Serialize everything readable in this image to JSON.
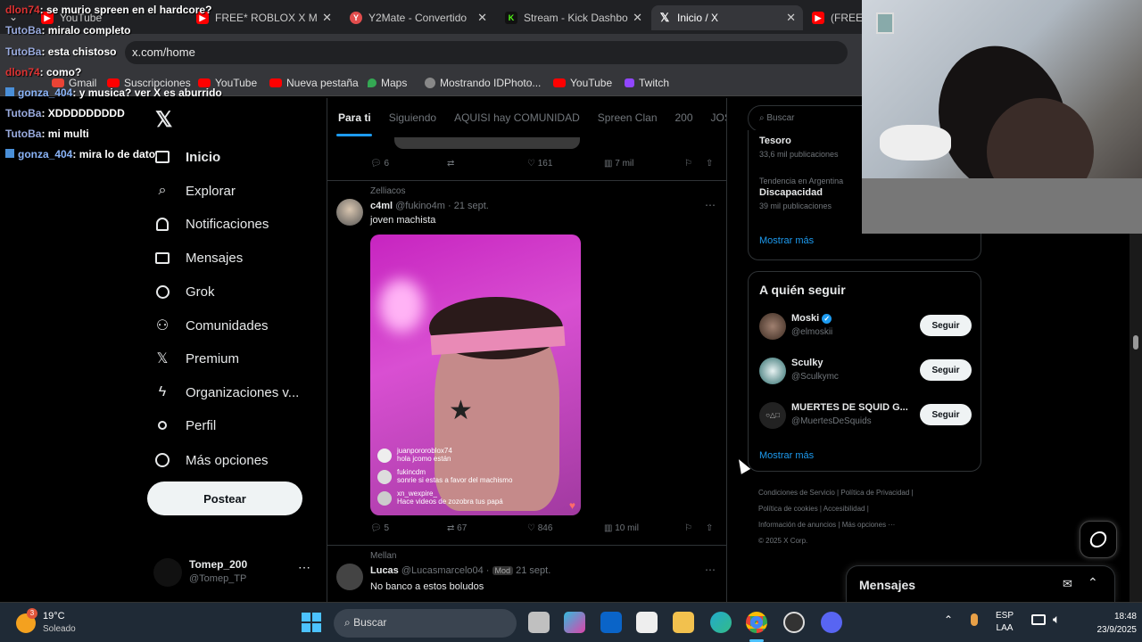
{
  "browser": {
    "tabs": [
      {
        "label": "YouTube",
        "color": "#ff0000"
      },
      {
        "label": "FREE* ROBLOX X M",
        "color": "#ff0000"
      },
      {
        "label": "Y2Mate - Convertido",
        "color": "#e24d4d"
      },
      {
        "label": "Stream - Kick Dashbo",
        "color": "#53fc18"
      },
      {
        "label": "Inicio / X",
        "color": "#000000"
      },
      {
        "label": "(FREE)",
        "color": "#ff0000"
      }
    ],
    "url": "x.com/home",
    "bookmarks": [
      "Gmail",
      "Suscripciones",
      "YouTube",
      "Nueva pestaña",
      "Maps",
      "Mostrando IDPhoto...",
      "YouTube",
      "Twitch"
    ]
  },
  "chat": [
    {
      "user": "dlon74",
      "text": ": se murio spreen en el hardcore?"
    },
    {
      "user": "TutoBa",
      "text": ": miralo completo"
    },
    {
      "user": "TutoBa",
      "text": ": esta chistoso"
    },
    {
      "user": "dlon74",
      "text": ": como?"
    },
    {
      "user": "gonza_404",
      "text": ": y musica? ver X es aburrido"
    },
    {
      "user": "TutoBa",
      "text": ": XDDDDDDDDD"
    },
    {
      "user": "TutoBa",
      "text": ": mi multi"
    },
    {
      "user": "gonza_404",
      "text": ": mira lo de dato"
    }
  ],
  "nav": {
    "items": [
      "Inicio",
      "Explorar",
      "Notificaciones",
      "Mensajes",
      "Grok",
      "Comunidades",
      "Premium",
      "Organizaciones v...",
      "Perfil",
      "Más opciones"
    ],
    "post_label": "Postear",
    "account_name": "Tomep_200",
    "account_handle": "@Tomep_TP"
  },
  "feed": {
    "tabs": [
      "Para ti",
      "Siguiendo",
      "AQUISI hay COMUNIDAD",
      "Spreen Clan",
      "200",
      "JOSI"
    ],
    "post0_actions": {
      "replies": "6",
      "likes": "161",
      "views": "7 mil"
    },
    "post1": {
      "context": "Zelliacos",
      "name": "c4ml",
      "handle": "@fukino4m · 21 sept.",
      "text": "joven machista",
      "overlay_comments": [
        {
          "user": "juanpororoblox74",
          "text": "hola jcomo están"
        },
        {
          "user": "fukincdm",
          "text": "sonrie si estas a favor del machismo"
        },
        {
          "user": "xn_wexpire_",
          "text": "Hace videos de zozobra tus papá"
        }
      ],
      "replies": "5",
      "reposts": "67",
      "likes": "846",
      "views": "10 mil"
    },
    "post2": {
      "context": "Mellan",
      "name": "Lucas",
      "handle": "@Lucasmarcelo04 ·",
      "badge": "Mod",
      "date": "21 sept.",
      "text": "No banco a estos boludos"
    }
  },
  "sidebar": {
    "search_placeholder": "Buscar",
    "trends": [
      {
        "name": "Tesoro",
        "count": "33,6 mil publicaciones"
      },
      {
        "context": "Tendencia en Argentina",
        "name": "Discapacidad",
        "count": "39 mil publicaciones"
      }
    ],
    "show_more": "Mostrar más",
    "follow_title": "A quién seguir",
    "follow": [
      {
        "name": "Moski",
        "handle": "@elmoskii",
        "btn": "Seguir"
      },
      {
        "name": "Sculky",
        "handle": "@Sculkymc",
        "btn": "Seguir"
      },
      {
        "name": "MUERTES DE SQUID G...",
        "handle": "@MuertesDeSquids",
        "btn": "Seguir"
      }
    ],
    "follow_more": "Mostrar más",
    "footer": [
      "Condiciones de Servicio",
      "Política de Privacidad",
      "Política de cookies",
      "Accesibilidad",
      "Información de anuncios",
      "Más opciones ···",
      "© 2025 X Corp."
    ],
    "messages_title": "Mensajes"
  },
  "taskbar": {
    "weather_temp": "19°C",
    "weather_text": "Soleado",
    "weather_badge": "3",
    "search_label": "Buscar",
    "lang": "ESP",
    "lang2": "LAA",
    "time": "18:48",
    "date": "23/9/2025"
  }
}
